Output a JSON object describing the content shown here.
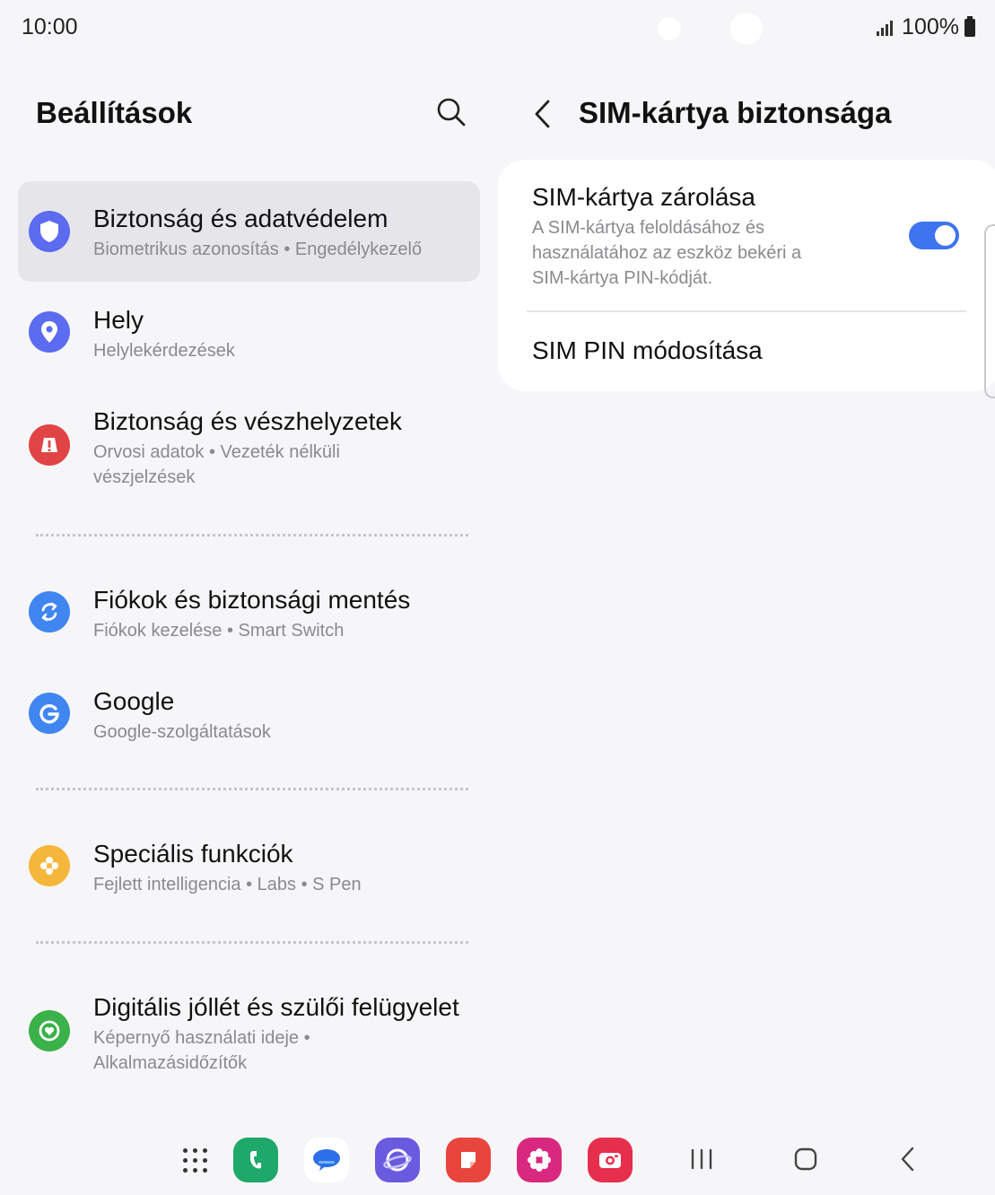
{
  "status_bar": {
    "time": "10:00",
    "battery": "100%"
  },
  "left_pane": {
    "title": "Beállítások",
    "items": [
      {
        "title": "Biztonság és adatvédelem",
        "subtitle": "Biometrikus azonosítás  •  Engedélykezelő",
        "icon": "shield-icon",
        "color": "#5b6cf0",
        "selected": true
      },
      {
        "title": "Hely",
        "subtitle": "Helylekérdezések",
        "icon": "location-pin-icon",
        "color": "#5b6cf0"
      },
      {
        "title": "Biztonság és vészhelyzetek",
        "subtitle": "Orvosi adatok  •  Vezeték nélküli vészjelzések",
        "icon": "emergency-icon",
        "color": "#e04444"
      },
      {
        "title": "Fiókok és biztonsági mentés",
        "subtitle": "Fiókok kezelése  •  Smart Switch",
        "icon": "sync-icon",
        "color": "#3f86f0"
      },
      {
        "title": "Google",
        "subtitle": "Google-szolgáltatások",
        "icon": "google-icon",
        "color": "#3f86f0"
      },
      {
        "title": "Speciális funkciók",
        "subtitle": "Fejlett intelligencia  •  Labs  •  S Pen",
        "icon": "advanced-features-icon",
        "color": "#f5b63c"
      },
      {
        "title": "Digitális jóllét és szülői felügyelet",
        "subtitle": "Képernyő használati ideje  •  Alkalmazásidőzítők",
        "icon": "wellbeing-icon",
        "color": "#3bb14a"
      }
    ]
  },
  "right_pane": {
    "title": "SIM-kártya biztonsága",
    "sim_lock": {
      "title": "SIM-kártya zárolása",
      "description": "A SIM-kártya feloldásához és használatához az eszköz bekéri a SIM-kártya PIN-kódját.",
      "enabled": true
    },
    "change_pin": "SIM PIN módosítása"
  },
  "colors": {
    "accent": "#3e74f0",
    "background": "#f6f6f8",
    "card": "#ffffff"
  },
  "dock_apps": [
    "apps-grid-icon",
    "phone-app-icon",
    "messages-app-icon",
    "internet-app-icon",
    "notes-app-icon",
    "gallery-app-icon",
    "camera-app-icon"
  ],
  "nav_buttons": [
    "recents-button",
    "home-button",
    "back-button"
  ]
}
